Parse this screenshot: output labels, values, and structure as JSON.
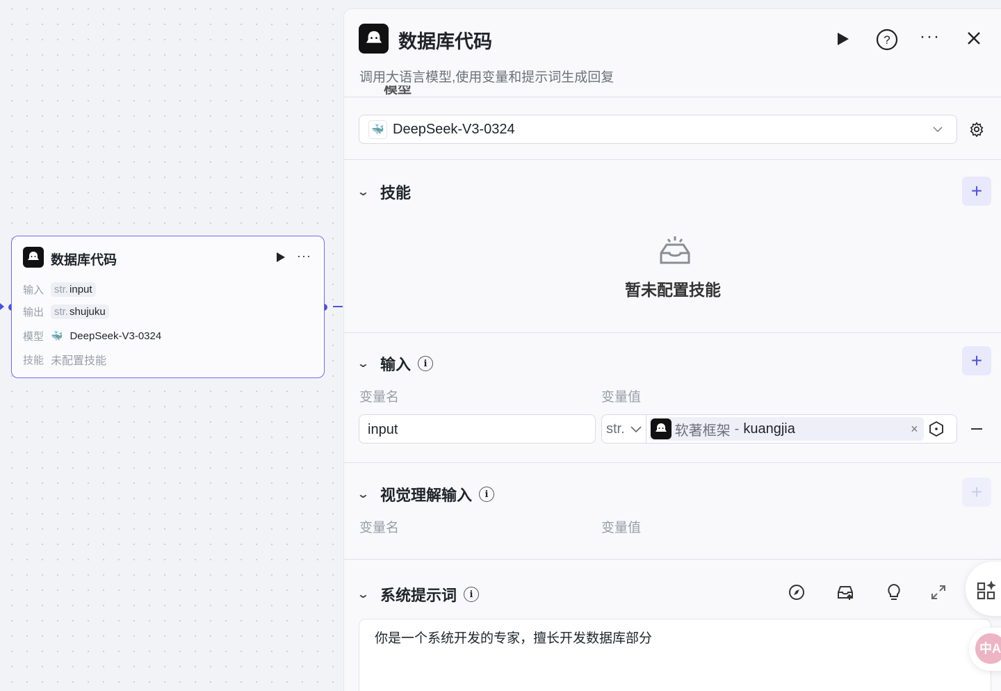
{
  "node": {
    "title": "数据库代码",
    "rows": [
      {
        "label": "输入",
        "type": "str.",
        "value": "input"
      },
      {
        "label": "输出",
        "type": "str.",
        "value": "shujuku"
      },
      {
        "label": "模型",
        "value": "DeepSeek-V3-0324"
      },
      {
        "label": "技能",
        "value": "未配置技能"
      }
    ]
  },
  "panel": {
    "title": "数据库代码",
    "description": "调用大语言模型,使用变量和提示词生成回复",
    "model": {
      "label": "模型",
      "selected": "DeepSeek-V3-0324"
    },
    "skills": {
      "title": "技能",
      "empty": "暂未配置技能"
    },
    "input": {
      "title": "输入",
      "col_name": "变量名",
      "col_value": "变量值",
      "rows": [
        {
          "name": "input",
          "type": "str.",
          "ref_value": "软著框架",
          "ref_var": "kuangjia"
        }
      ]
    },
    "vision": {
      "title": "视觉理解输入",
      "col_name": "变量名",
      "col_value": "变量值"
    },
    "system_prompt": {
      "title": "系统提示词",
      "value": "你是一个系统开发的专家，擅长开发数据库部分"
    }
  },
  "colors": {
    "accent": "#4d50e0",
    "border": "#6b6ef0"
  }
}
